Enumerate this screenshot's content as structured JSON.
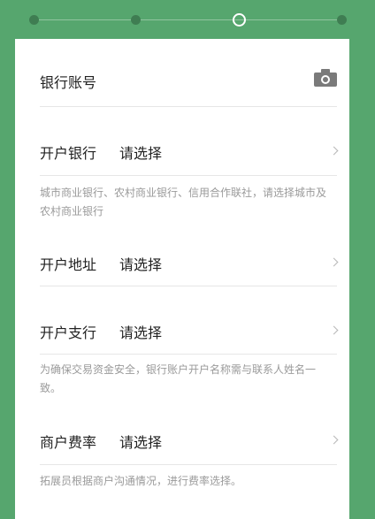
{
  "stepper": {
    "total_steps": 4,
    "current_step": 3
  },
  "colors": {
    "background": "#56a66e",
    "card": "#ffffff",
    "text": "#222222",
    "hint": "#9a9a9a"
  },
  "account": {
    "label": "银行账号",
    "camera_icon": "camera-icon"
  },
  "bank": {
    "label": "开户银行",
    "value": "请选择",
    "note": "城市商业银行、农村商业银行、信用合作联社，请选择城市及农村商业银行"
  },
  "address": {
    "label": "开户地址",
    "value": "请选择"
  },
  "branch": {
    "label": "开户支行",
    "value": "请选择",
    "note": "为确保交易资金安全，银行账户开户名称需与联系人姓名一致。"
  },
  "rate": {
    "label": "商户费率",
    "value": "请选择",
    "note": "拓展员根据商户沟通情况，进行费率选择。"
  }
}
